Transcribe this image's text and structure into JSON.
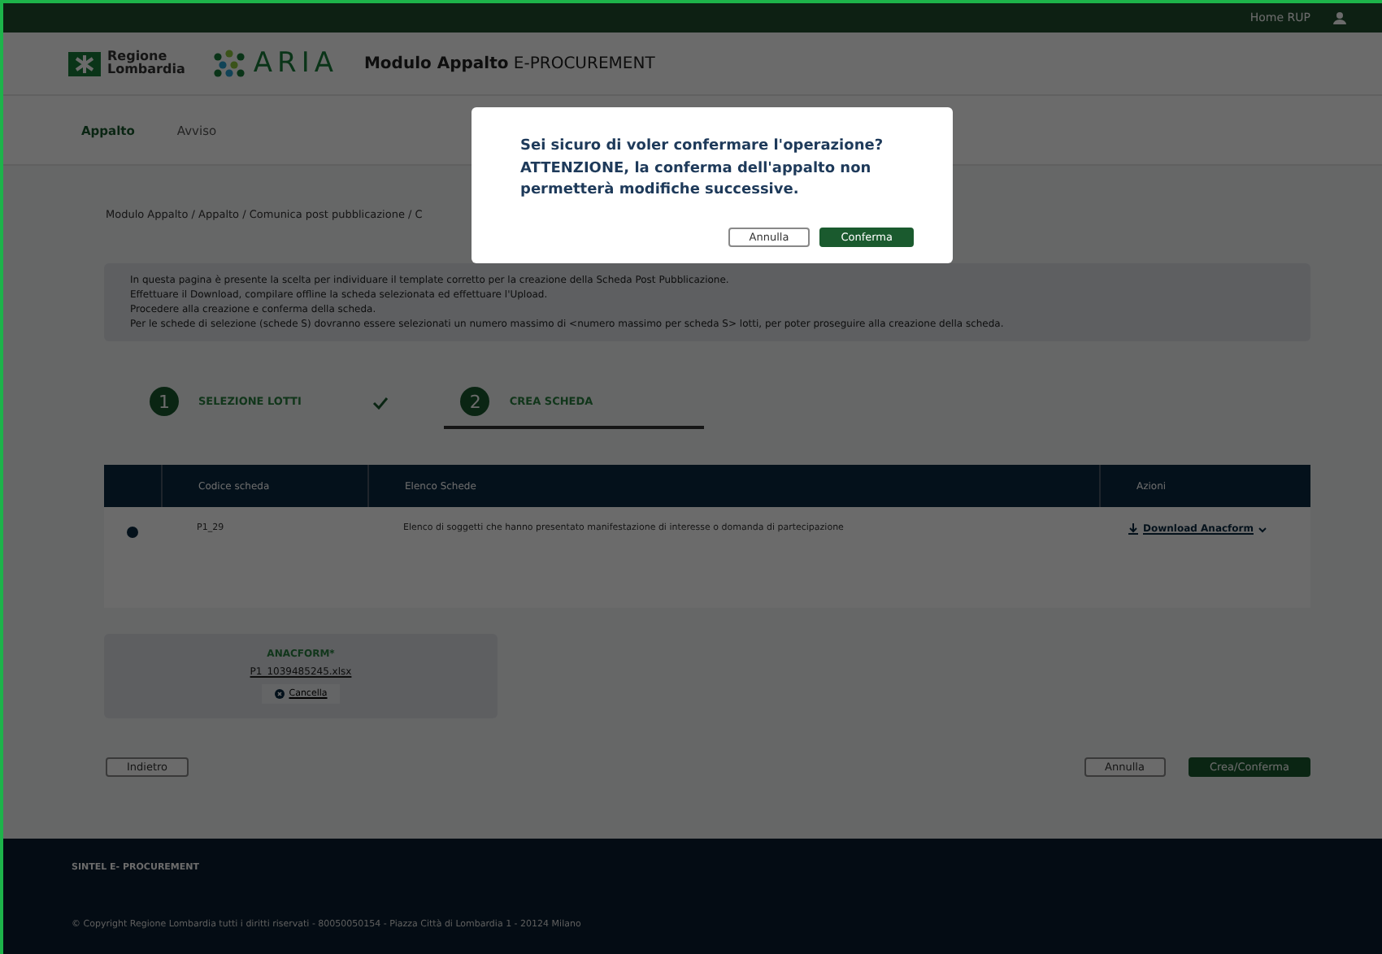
{
  "topbar": {
    "link": "Home RUP"
  },
  "header": {
    "region_logo": "Regione\nLombardia",
    "aria_logo": "ARIA",
    "module": "Modulo Appalto",
    "product": "E-PROCUREMENT"
  },
  "nav": [
    {
      "label": "Appalto",
      "selected": true
    },
    {
      "label": "Avviso",
      "selected": false
    }
  ],
  "breadcrumb": "Modulo Appalto / Appalto / Comunica post pubblicazione / C",
  "info": [
    "In questa pagina è presente la scelta per individuare il template corretto per la creazione della Scheda Post Pubblicazione.",
    "Effettuare il Download, compilare offline la scheda selezionata ed effettuare l'Upload.",
    "Procedere alla creazione e conferma della scheda.",
    "Per le schede di selezione (schede S) dovranno essere selezionati un numero massimo di <numero massimo per scheda S> lotti, per poter proseguire alla creazione della scheda."
  ],
  "steps": [
    {
      "number": "1",
      "label": "SELEZIONE LOTTI",
      "selected": false,
      "done": true
    },
    {
      "number": "2",
      "label": "CREA SCHEDA",
      "selected": true,
      "done": false
    }
  ],
  "table": {
    "columns": [
      "Codice scheda",
      "Elenco Schede",
      "Azioni"
    ],
    "rows": [
      {
        "selected": true,
        "code": "P1_29",
        "description": "Elenco di soggetti che hanno presentato manifestazione di interesse o domanda di partecipazione",
        "action": "Download Anacform"
      }
    ]
  },
  "upload": {
    "title": "ANACFORM*",
    "file": "P1_1039485245.xlsx",
    "delete": "Cancella"
  },
  "buttons": {
    "back": "Indietro",
    "cancel": "Annulla",
    "confirm": "Crea/Conferma"
  },
  "footer": {
    "title": "SINTEL E- PROCUREMENT",
    "copyright": "© Copyright Regione Lombardia tutti i diritti riservati - 80050050154 - Piazza Città di Lombardia 1 - 20124 Milano"
  },
  "modal": {
    "message": "Sei sicuro di voler confermare l'operazione? ATTENZIONE, la conferma dell'appalto non permetterà modifiche successive.",
    "cancel": "Annulla",
    "confirm": "Conferma"
  }
}
